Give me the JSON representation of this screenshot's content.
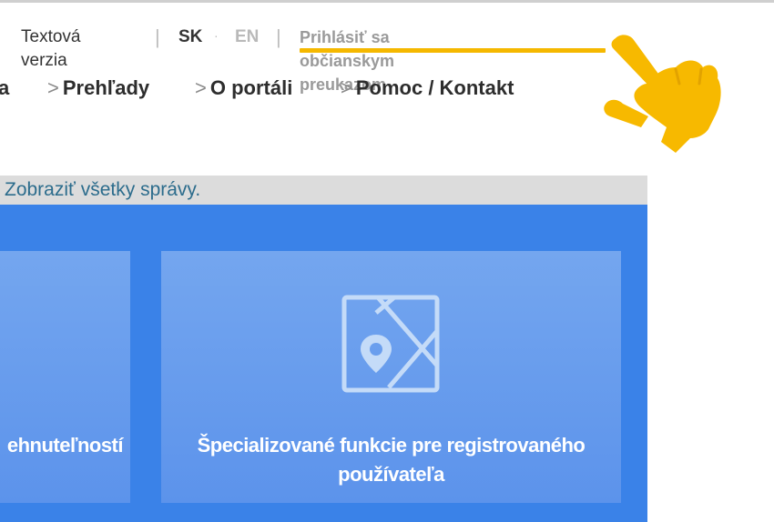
{
  "utility": {
    "text_version": "Textová verzia",
    "separator": "|",
    "lang_sk": "SK",
    "lang_dot": "·",
    "lang_en": "EN",
    "login": "Prihlásiť sa občianskym preukazom"
  },
  "nav": {
    "chevron": ">",
    "partial_item": "a",
    "items": [
      "Prehľady",
      "O portáli",
      "Pomoc / Kontakt"
    ]
  },
  "notice": {
    "text": "Zobraziť všetky správy."
  },
  "cards": {
    "left_label": "ehnuteľností",
    "right_label": "Špecializované funkcie pre registrovaného používateľa"
  },
  "colors": {
    "accent_underline": "#f5b800",
    "panel_blue": "#3a82e8",
    "card_blue": "#6a9fee",
    "hand": "#f7b900"
  },
  "icons": {
    "map": "map-pin-icon",
    "hand": "hand-pointer-icon"
  }
}
